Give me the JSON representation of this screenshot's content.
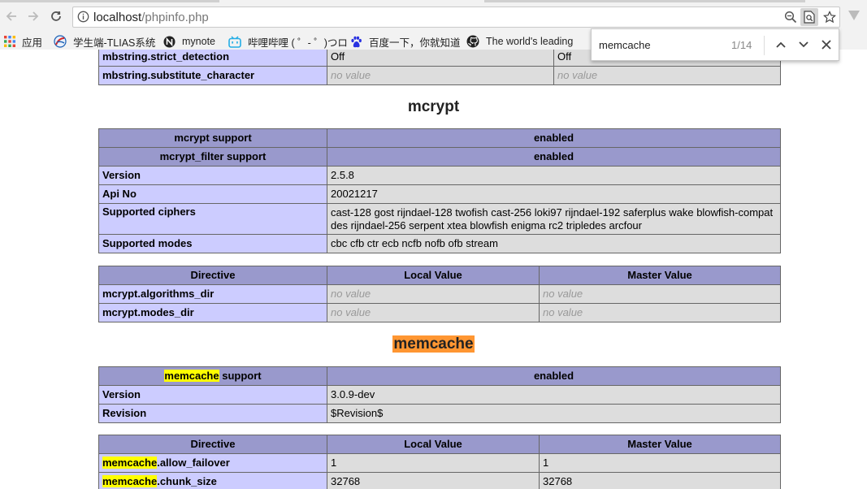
{
  "browser": {
    "url_host": "localhost",
    "url_path": "/phpinfo.php",
    "bookmarks": [
      {
        "label": "应用",
        "icon": "apps-grid-icon"
      },
      {
        "label": "学生端-TLIAS系统",
        "icon": "tlias-logo-icon"
      },
      {
        "label": "mynote",
        "icon": "notion-logo-icon"
      },
      {
        "label": "哔哩哔哩 ( ゜- ゜)つロ",
        "icon": "bilibili-logo-icon"
      },
      {
        "label": "百度一下，你就知道",
        "icon": "baidu-paw-icon"
      },
      {
        "label": "The world's leading",
        "icon": "github-logo-icon"
      }
    ],
    "find": {
      "query": "memcache",
      "count": "1/14"
    }
  },
  "mbstring_tail": [
    {
      "name": "mbstring.strict_detection",
      "local": "Off",
      "master": "Off"
    },
    {
      "name": "mbstring.substitute_character",
      "local": "no value",
      "master": "no value"
    }
  ],
  "mcrypt": {
    "title": "mcrypt",
    "rows": [
      {
        "name": "mcrypt support",
        "value": "enabled"
      },
      {
        "name": "mcrypt_filter support",
        "value": "enabled"
      },
      {
        "name": "Version",
        "value": "2.5.8"
      },
      {
        "name": "Api No",
        "value": "20021217"
      },
      {
        "name": "Supported ciphers",
        "value": "cast-128 gost rijndael-128 twofish cast-256 loki97 rijndael-192 saferplus wake blowfish-compat des rijndael-256 serpent xtea blowfish enigma rc2 tripledes arcfour"
      },
      {
        "name": "Supported modes",
        "value": "cbc cfb ctr ecb ncfb nofb ofb stream"
      }
    ],
    "directive_headers": {
      "directive": "Directive",
      "local": "Local Value",
      "master": "Master Value"
    },
    "directives": [
      {
        "name": "mcrypt.algorithms_dir",
        "local": "no value",
        "master": "no value"
      },
      {
        "name": "mcrypt.modes_dir",
        "local": "no value",
        "master": "no value"
      }
    ]
  },
  "memcache": {
    "title": "memcache",
    "support_rest": " support",
    "support_value": "enabled",
    "rows": [
      {
        "name": "Version",
        "value": "3.0.9-dev"
      },
      {
        "name": "Revision",
        "value": "$Revision$"
      }
    ],
    "directive_headers": {
      "directive": "Directive",
      "local": "Local Value",
      "master": "Master Value"
    },
    "directives": [
      {
        "name_rest": ".allow_failover",
        "local": "1",
        "master": "1"
      },
      {
        "name_rest": ".chunk_size",
        "local": "32768",
        "master": "32768"
      }
    ]
  },
  "colors": {
    "header": "#9999cc",
    "entry": "#ccccff",
    "value": "#dddddd",
    "match": "#ffff00",
    "current_match": "#ff9632"
  }
}
